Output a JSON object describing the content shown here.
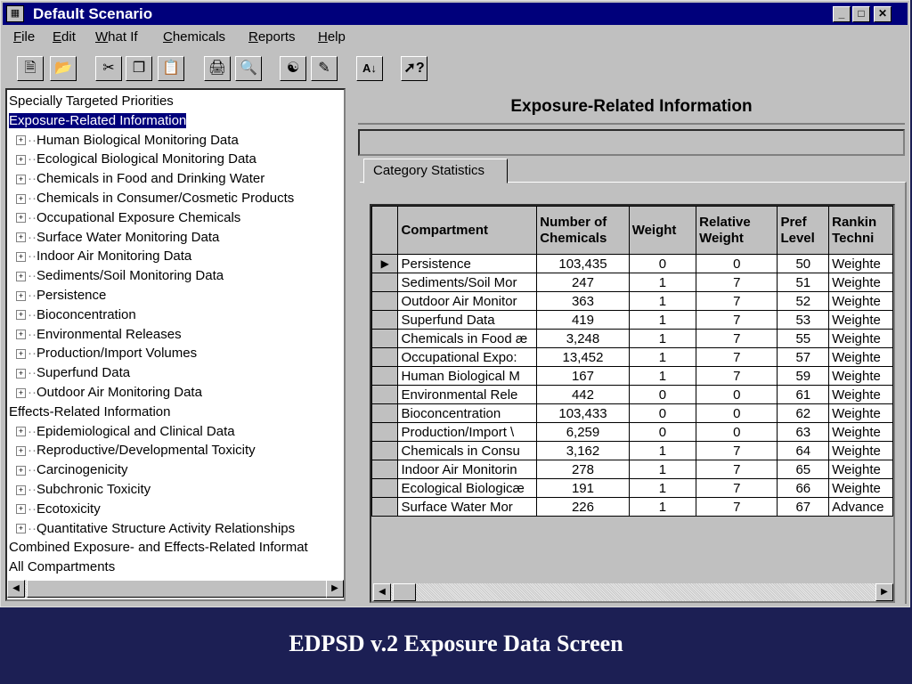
{
  "window": {
    "title": "Default Scenario"
  },
  "menu": [
    {
      "first": "F",
      "rest": "ile"
    },
    {
      "first": "E",
      "rest": "dit"
    },
    {
      "first": "W",
      "rest": "hat If"
    },
    {
      "first": "C",
      "rest": "hemicals"
    },
    {
      "first": "R",
      "rest": "eports"
    },
    {
      "first": "H",
      "rest": "elp"
    }
  ],
  "tree": {
    "items": [
      {
        "label": "Specially Targeted Priorities",
        "level": 0
      },
      {
        "label": "Exposure-Related Information",
        "level": 0,
        "selected": true
      },
      {
        "label": "Human Biological Monitoring Data",
        "level": 1
      },
      {
        "label": "Ecological Biological Monitoring Data",
        "level": 1
      },
      {
        "label": "Chemicals in Food and Drinking Water",
        "level": 1
      },
      {
        "label": "Chemicals in Consumer/Cosmetic Products",
        "level": 1
      },
      {
        "label": "Occupational Exposure Chemicals",
        "level": 1
      },
      {
        "label": "Surface Water Monitoring Data",
        "level": 1
      },
      {
        "label": "Indoor Air Monitoring Data",
        "level": 1
      },
      {
        "label": "Sediments/Soil Monitoring Data",
        "level": 1
      },
      {
        "label": "Persistence",
        "level": 1
      },
      {
        "label": "Bioconcentration",
        "level": 1
      },
      {
        "label": "Environmental Releases",
        "level": 1
      },
      {
        "label": "Production/Import Volumes",
        "level": 1
      },
      {
        "label": "Superfund Data",
        "level": 1
      },
      {
        "label": "Outdoor Air Monitoring Data",
        "level": 1
      },
      {
        "label": "Effects-Related Information",
        "level": 0
      },
      {
        "label": "Epidemiological and Clinical Data",
        "level": 1
      },
      {
        "label": "Reproductive/Developmental Toxicity",
        "level": 1
      },
      {
        "label": "Carcinogenicity",
        "level": 1
      },
      {
        "label": "Subchronic Toxicity",
        "level": 1
      },
      {
        "label": "Ecotoxicity",
        "level": 1
      },
      {
        "label": "Quantitative Structure Activity Relationships",
        "level": 1
      },
      {
        "label": "Combined Exposure- and Effects-Related Informat",
        "level": 0
      },
      {
        "label": "All Compartments",
        "level": 0
      }
    ]
  },
  "panel": {
    "header": "Exposure-Related Information",
    "tab": "Category Statistics"
  },
  "grid": {
    "columns": [
      {
        "line1": "Compartment",
        "line2": ""
      },
      {
        "line1": "Number of",
        "line2": "Chemicals"
      },
      {
        "line1": "Weight",
        "line2": ""
      },
      {
        "line1": "Relative",
        "line2": "Weight"
      },
      {
        "line1": "Pref",
        "line2": "Level"
      },
      {
        "line1": "Rankin",
        "line2": "Techni"
      }
    ],
    "rows": [
      [
        "Persistence",
        "103,435",
        "0",
        "0",
        "50",
        "Weighte"
      ],
      [
        "Sediments/Soil Mor",
        "247",
        "1",
        "7",
        "51",
        "Weighte"
      ],
      [
        "Outdoor Air Monitor",
        "363",
        "1",
        "7",
        "52",
        "Weighte"
      ],
      [
        "Superfund Data",
        "419",
        "1",
        "7",
        "53",
        "Weighte"
      ],
      [
        "Chemicals in Food æ",
        "3,248",
        "1",
        "7",
        "55",
        "Weighte"
      ],
      [
        "Occupational Expo:",
        "13,452",
        "1",
        "7",
        "57",
        "Weighte"
      ],
      [
        "Human Biological M",
        "167",
        "1",
        "7",
        "59",
        "Weighte"
      ],
      [
        "Environmental Rele",
        "442",
        "0",
        "0",
        "61",
        "Weighte"
      ],
      [
        "Bioconcentration",
        "103,433",
        "0",
        "0",
        "62",
        "Weighte"
      ],
      [
        "Production/Import \\",
        "6,259",
        "0",
        "0",
        "63",
        "Weighte"
      ],
      [
        "Chemicals in Consu",
        "3,162",
        "1",
        "7",
        "64",
        "Weighte"
      ],
      [
        "Indoor Air Monitorin",
        "278",
        "1",
        "7",
        "65",
        "Weighte"
      ],
      [
        "Ecological Biologicæ",
        "191",
        "1",
        "7",
        "66",
        "Weighte"
      ],
      [
        "Surface Water Mor",
        "226",
        "1",
        "7",
        "67",
        "Advance"
      ]
    ],
    "current_row": 0
  },
  "caption": "EDPSD v.2 Exposure Data Screen"
}
